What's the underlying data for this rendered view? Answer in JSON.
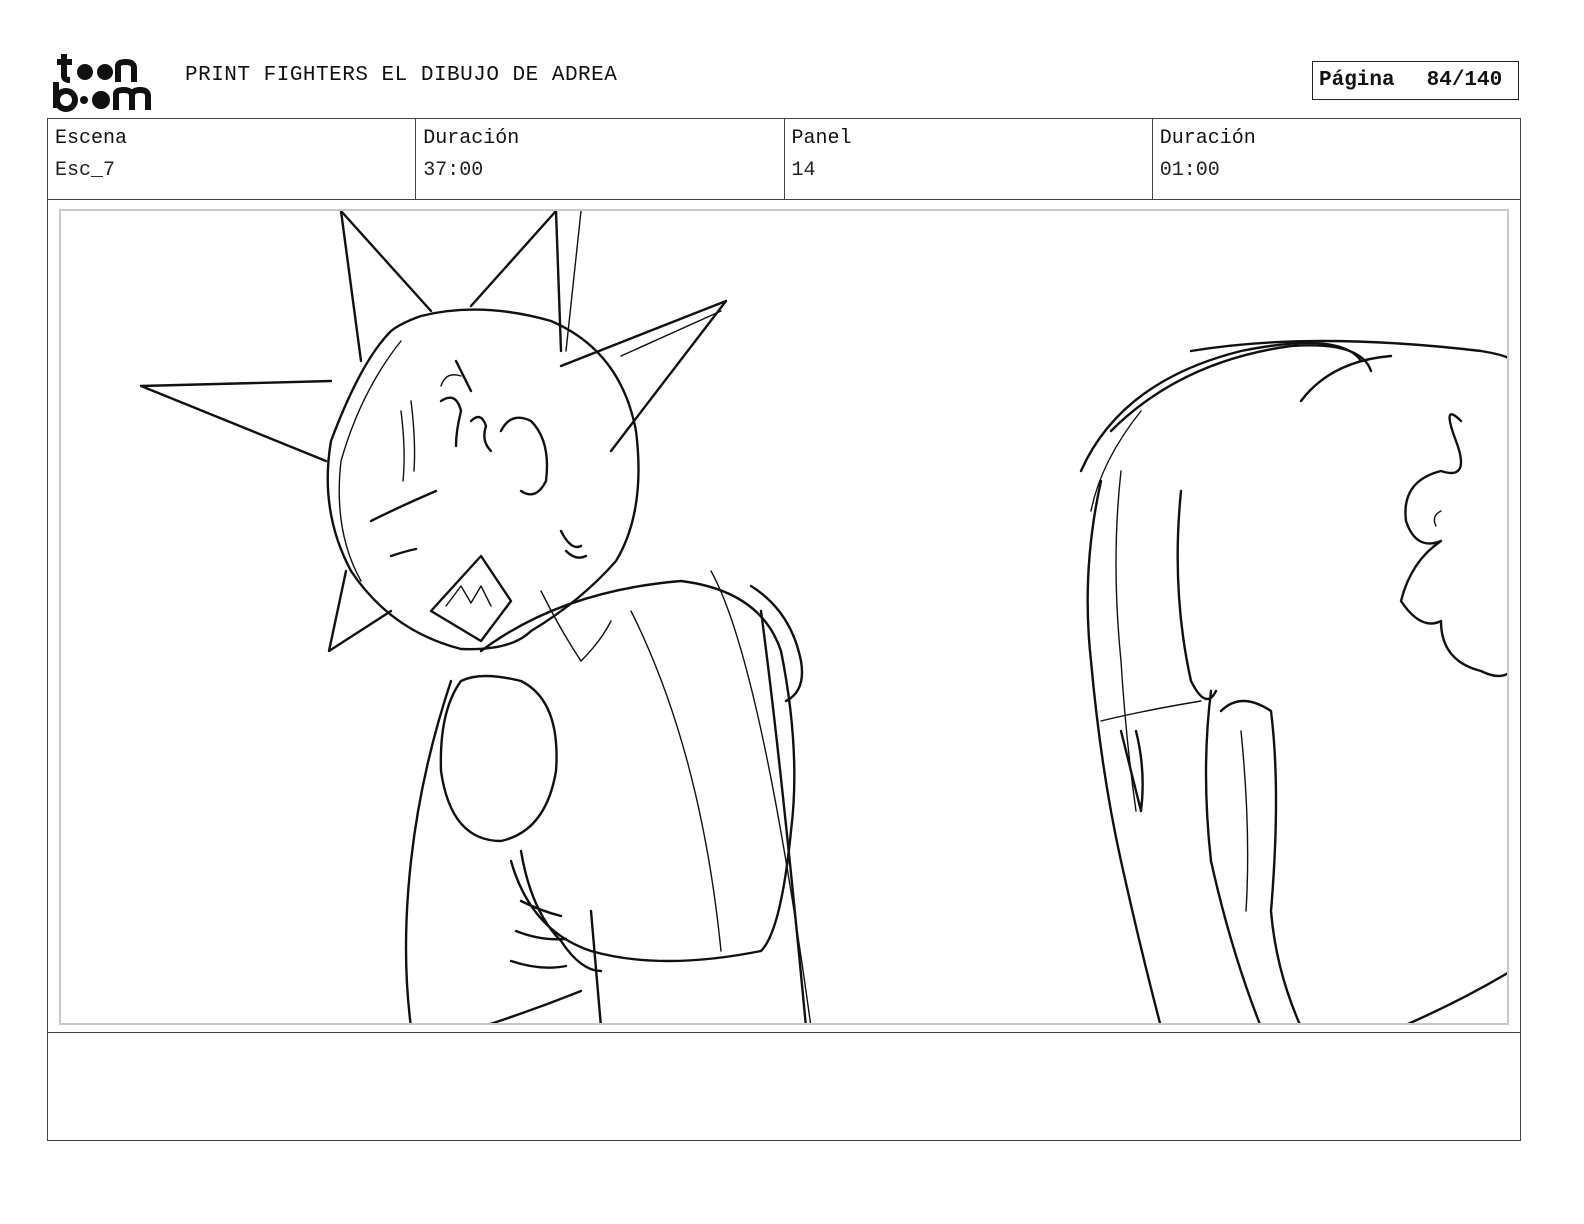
{
  "logo": {
    "line1": "t  n",
    "line2": "b  m"
  },
  "header": {
    "title": "PRINT FIGHTERS EL DIBUJO DE ADREA",
    "page_label": "Página",
    "page_value": "84/140"
  },
  "info": {
    "scene_label": "Escena",
    "scene_value": "Esc_7",
    "scene_duration_label": "Duración",
    "scene_duration_value": "37:00",
    "panel_label": "Panel",
    "panel_value": "14",
    "panel_duration_label": "Duración",
    "panel_duration_value": "01:00"
  },
  "notes": {
    "text": ""
  }
}
